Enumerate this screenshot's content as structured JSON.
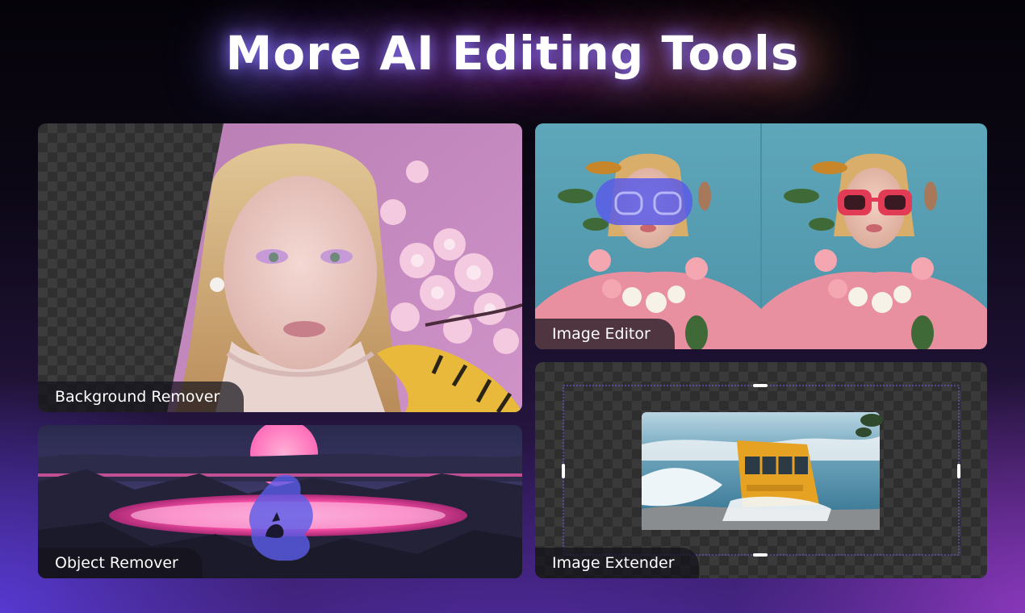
{
  "page": {
    "title": "More AI Editing Tools"
  },
  "tools": {
    "background_remover": {
      "label": "Background Remover"
    },
    "image_editor": {
      "label": "Image Editor"
    },
    "object_remover": {
      "label": "Object Remover"
    },
    "image_extender": {
      "label": "Image Extender"
    }
  },
  "colors": {
    "accent_blue": "#6f62f5",
    "accent_pink": "#ff4fa8",
    "mask_purple": "#5a5ce8"
  }
}
